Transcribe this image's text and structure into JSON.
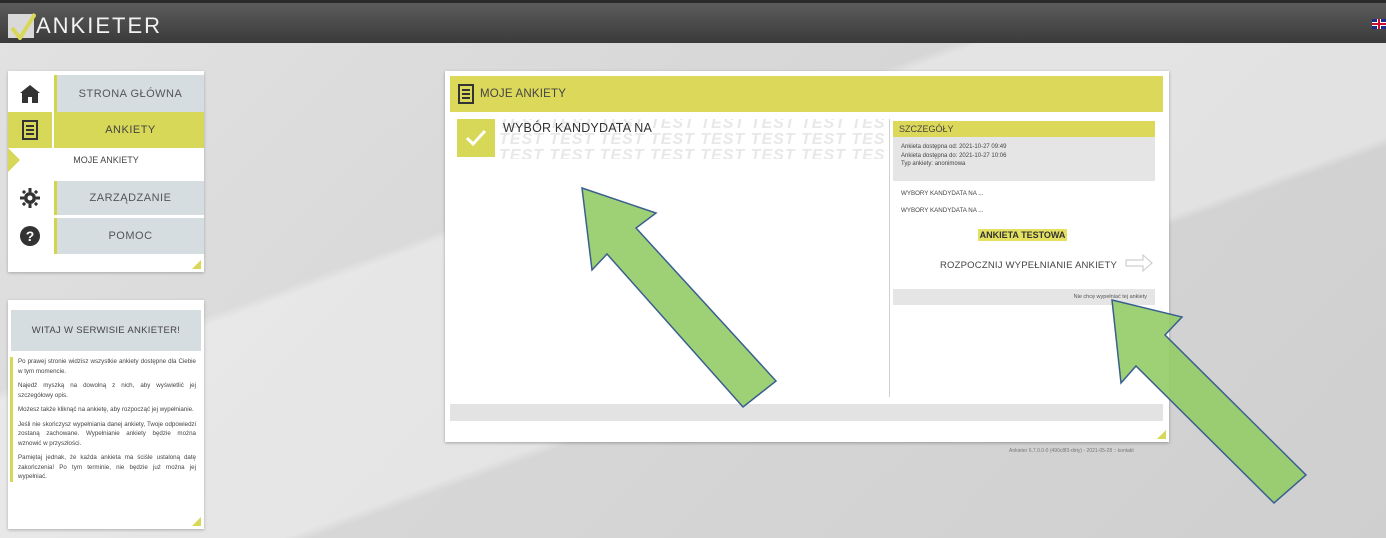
{
  "brand": {
    "name": "ANKIETER"
  },
  "nav": {
    "items": [
      {
        "label": "STRONA GŁÓWNA",
        "icon": "home-icon"
      },
      {
        "label": "ANKIETY",
        "icon": "document-list-icon"
      },
      {
        "label": "ZARZĄDZANIE",
        "icon": "gear-icon"
      },
      {
        "label": "POMOC",
        "icon": "help-icon"
      }
    ],
    "sub_item": "MOJE ANKIETY"
  },
  "welcome": {
    "title": "WITAJ W SERWISIE ANKIETER!",
    "paragraphs": [
      "Po prawej stronie widzisz wszystkie ankiety dostępne dla Ciebie w tym momencie.",
      "Najedź myszką na dowolną z nich, aby wyświetlić jej szczegółowy opis.",
      "Możesz także kliknąć na ankietę, aby rozpocząć jej wypełnianie.",
      "Jeśli nie skończysz wypełniania danej ankiety, Twoje odpowiedzi zostaną zachowane. Wypełnianie ankiety będzie można wznowić w przyszłości.",
      "Pamiętaj jednak, że każda ankieta ma ściśle ustaloną datę zakończenia! Po tym terminie, nie będzie już można jej wypełniać."
    ]
  },
  "main": {
    "title": "MOJE ANKIETY",
    "survey": {
      "title": "WYBÓR KANDYDATA NA",
      "watermark": "TEST TEST TEST TEST TEST TEST TEST TEST"
    },
    "details": {
      "heading": "SZCZEGÓŁY",
      "available_from_label": "Ankieta dostępna od:",
      "available_from": "2021-10-27 09:49",
      "available_to_label": "Ankieta dostępna do:",
      "available_to": "2021-10-27 10:06",
      "type_label": "Typ ankiety:",
      "type": "anonimowa",
      "line1": "WYBORY KANDYDATA NA ...",
      "line2": "WYBORY KANDYDATA NA ...",
      "test_label": "ANKIETA TESTOWA",
      "start_label": "ROZPOCZNIJ WYPEŁNIANIE ANKIETY",
      "decline_label": "Nie chcę wypełniać tej ankiety"
    }
  },
  "footer": {
    "version": "Ankieter 6.7.0.0-0 (490c8f3-dirty) - 2021-05-28 :: kontakt"
  },
  "colors": {
    "accent": "#d7d758",
    "nav_bg": "#d5dde1",
    "annotation_arrow": "#93cc66"
  }
}
